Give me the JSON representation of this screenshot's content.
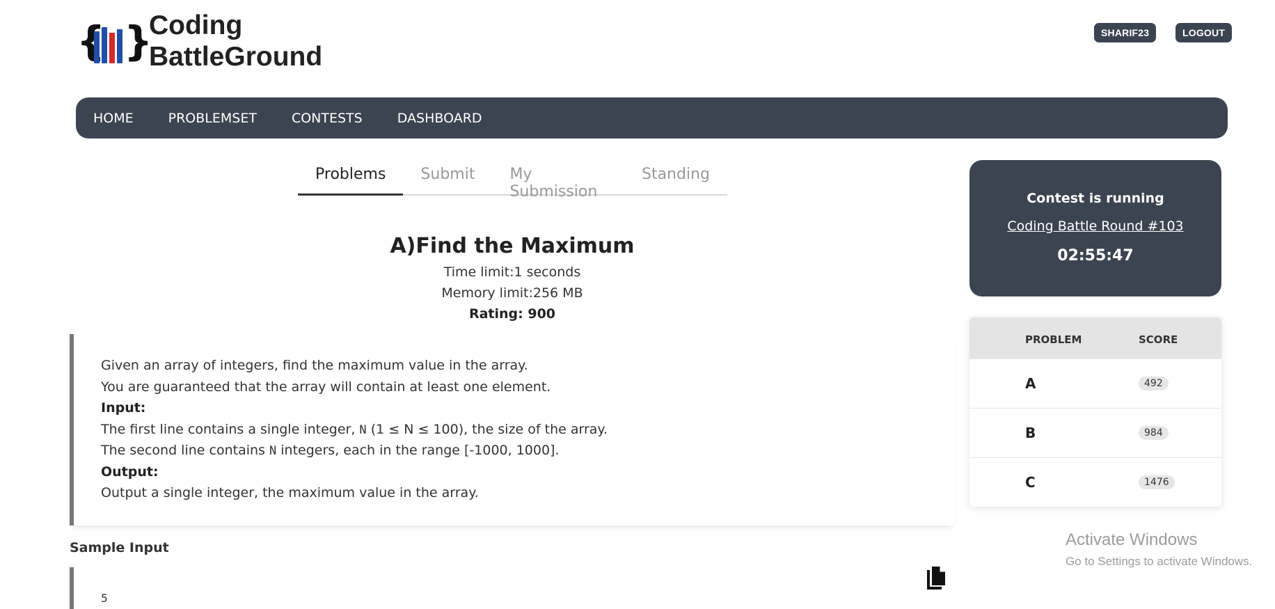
{
  "header": {
    "logo_text_line1": "Coding",
    "logo_text_line2": "BattleGround",
    "logo_brace_left": "{",
    "logo_brace_right": "}",
    "username_button": "SHARIF23",
    "logout_button": "LOGOUT"
  },
  "nav": {
    "items": [
      "HOME",
      "PROBLEMSET",
      "CONTESTS",
      "DASHBOARD"
    ]
  },
  "tabs": {
    "items": [
      "Problems",
      "Submit",
      "My Submission",
      "Standing"
    ],
    "active": "Problems"
  },
  "problem": {
    "title": "A)Find the Maximum",
    "time_limit": "Time limit:1 seconds",
    "memory_limit": "Memory limit:256 MB",
    "rating": "Rating: 900",
    "statement": {
      "line1": "Given an array of integers, find the maximum value in the array.",
      "line2": "You are guaranteed that the array will contain at least one element.",
      "input_heading": "Input:",
      "input_line1_pre": "The first line contains a single integer, ",
      "input_line1_code": "N",
      "input_line1_post": " (1 ≤ N ≤ 100), the size of the array.",
      "input_line2_pre": "The second line contains ",
      "input_line2_code": "N",
      "input_line2_post": " integers, each in the range [-1000, 1000].",
      "output_heading": "Output:",
      "output_line1": "Output a single integer, the maximum value in the array."
    },
    "sample_label": "Sample Input",
    "sample_input_first_line": "5"
  },
  "contest": {
    "status": "Contest is running",
    "round_name": "Coding Battle Round #103",
    "timer": "02:55:47"
  },
  "score_table": {
    "headers": [
      "PROBLEM",
      "SCORE"
    ],
    "rows": [
      {
        "problem": "A",
        "score": "492"
      },
      {
        "problem": "B",
        "score": "984"
      },
      {
        "problem": "C",
        "score": "1476"
      }
    ]
  },
  "watermark": {
    "title": "Activate Windows",
    "subtitle": "Go to Settings to activate Windows."
  },
  "colors": {
    "dark": "#3c4451",
    "logo_blue": "#1f4fa8",
    "logo_red": "#d62828"
  }
}
